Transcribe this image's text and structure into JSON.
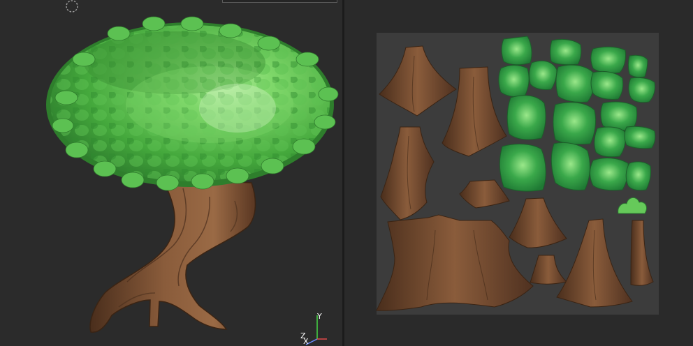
{
  "viewport": {
    "axes": {
      "y": "Y",
      "z": "Z",
      "x": "X"
    },
    "colors": {
      "foliage": "#4fb84a",
      "foliage_light": "#8fe07a",
      "bark": "#7a5035",
      "bark_dark": "#4a2e1c"
    }
  },
  "uv_editor": {
    "colors": {
      "canvas": "#3c3c3c",
      "leaf": "#2f9a3f",
      "bark": "#6b4429"
    }
  }
}
